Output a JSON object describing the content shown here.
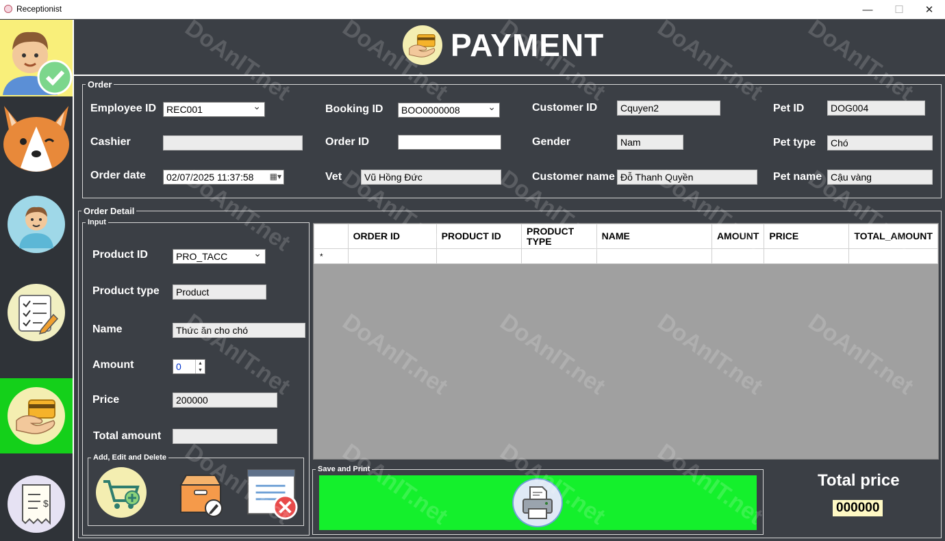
{
  "window": {
    "title": "Receptionist"
  },
  "header": {
    "title": "PAYMENT"
  },
  "order": {
    "legend": "Order",
    "employee_id_label": "Employee ID",
    "employee_id_value": "REC001",
    "booking_id_label": "Booking ID",
    "booking_id_value": "BOO0000008",
    "customer_id_label": "Customer ID",
    "customer_id_value": "Cquyen2",
    "pet_id_label": "Pet ID",
    "pet_id_value": "DOG004",
    "cashier_label": "Cashier",
    "cashier_value": "",
    "order_id_label": "Order ID",
    "order_id_value": "",
    "gender_label": "Gender",
    "gender_value": "Nam",
    "pet_type_label": "Pet type",
    "pet_type_value": "Chó",
    "order_date_label": "Order date",
    "order_date_value": "02/07/2025 11:37:58",
    "vet_label": "Vet",
    "vet_value": "Vũ Hồng Đức",
    "customer_name_label": "Customer name",
    "customer_name_value": "Đỗ Thanh Quyền",
    "pet_name_label": "Pet name",
    "pet_name_value": "Cậu vàng"
  },
  "order_detail": {
    "legend": "Order Detail",
    "input_legend": "Input",
    "product_id_label": "Product ID",
    "product_id_value": "PRO_TACC",
    "product_type_label": "Product type",
    "product_type_value": "Product",
    "name_label": "Name",
    "name_value": "Thức ăn cho chó",
    "amount_label": "Amount",
    "amount_value": "0",
    "price_label": "Price",
    "price_value": "200000",
    "total_amount_label": "Total amount",
    "total_amount_value": "",
    "actions_legend": "Add, Edit and Delete"
  },
  "grid": {
    "columns": [
      "ORDER ID",
      "PRODUCT ID",
      "PRODUCT TYPE",
      "NAME",
      "AMOUNT",
      "PRICE",
      "TOTAL_AMOUNT"
    ],
    "new_row_marker": "*"
  },
  "save": {
    "legend": "Save and Print"
  },
  "total": {
    "label": "Total price",
    "value": "000000"
  },
  "watermark": {
    "text": "DoAnIT.net"
  },
  "colors": {
    "background": "#3b3f45",
    "sidebar_active_green": "#14d01a",
    "sidebar_active_yellow": "#f9ef7a",
    "save_bar": "#14f02c"
  },
  "sidebar_icons": [
    "receptionist-check-icon",
    "corgi-icon",
    "customer-icon",
    "checklist-icon",
    "payment-card-icon",
    "invoice-icon"
  ]
}
